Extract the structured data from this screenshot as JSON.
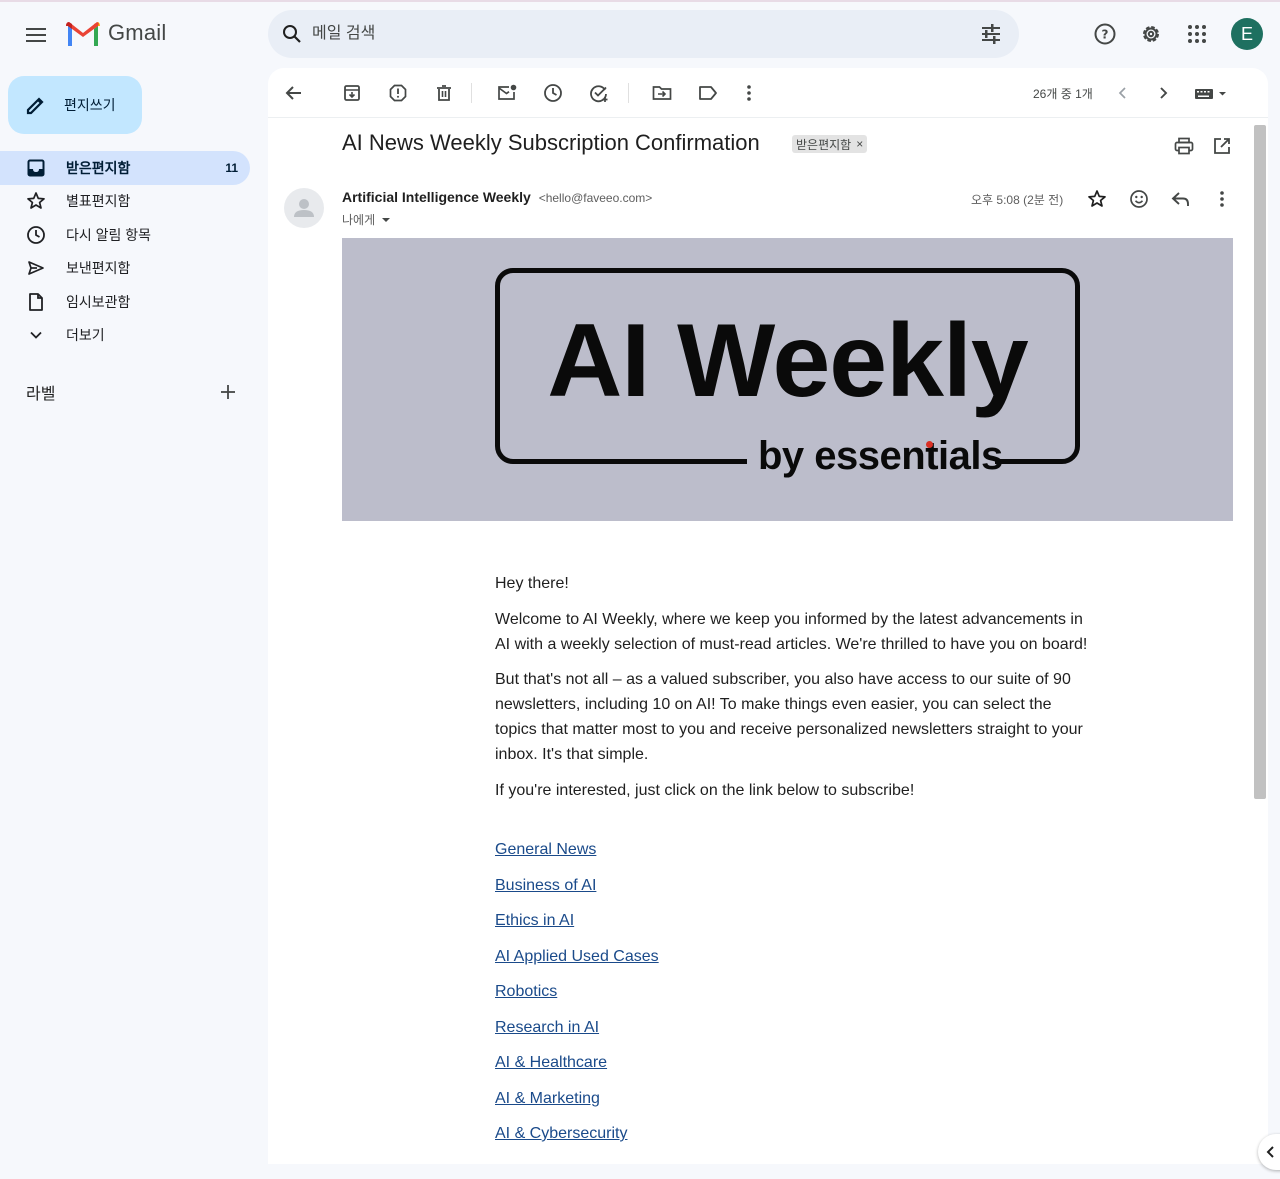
{
  "app": {
    "name": "Gmail"
  },
  "search": {
    "placeholder": "메일 검색"
  },
  "compose": {
    "label": "편지쓰기"
  },
  "sidebar": {
    "items": [
      {
        "label": "받은편지함",
        "count": "11"
      },
      {
        "label": "별표편지함"
      },
      {
        "label": "다시 알림 항목"
      },
      {
        "label": "보낸편지함"
      },
      {
        "label": "임시보관함"
      },
      {
        "label": "더보기"
      }
    ],
    "labels_heading": "라벨"
  },
  "toolbar": {
    "pager": "26개 중 1개"
  },
  "email": {
    "subject": "AI News Weekly Subscription Confirmation",
    "label_badge": "받은편지함",
    "sender_name": "Artificial Intelligence Weekly",
    "sender_email": "<hello@faveeo.com>",
    "to": "나에게",
    "time": "오후 5:08 (2분 전)",
    "banner": {
      "title": "AI Weekly",
      "subtitle": "by essentials"
    },
    "paragraphs": [
      "Hey there!",
      "Welcome to AI Weekly, where we keep you informed by the latest advancements in AI with a weekly selection of must-read articles. We're thrilled to have you on board!",
      "But that's not all – as a valued subscriber, you also have access to our suite of 90 newsletters, including 10 on AI! To make things even easier, you can select the topics that matter most to you and receive personalized newsletters straight to your inbox. It's that simple.",
      "If you're interested, just click on the link below to subscribe!"
    ],
    "links": [
      "General News",
      "Business of AI",
      "Ethics in AI",
      "AI Applied Used Cases",
      "Robotics",
      "Research in AI",
      "AI & Healthcare",
      "AI & Marketing",
      "AI & Cybersecurity"
    ]
  },
  "colors": {
    "brand_blue": "#c2e7ff",
    "active_nav": "#d3e3fd",
    "avatar": "#1e7060",
    "banner_bg": "#bcbdcb",
    "link": "#1a4a8a"
  },
  "user": {
    "avatar_letter": "E"
  }
}
